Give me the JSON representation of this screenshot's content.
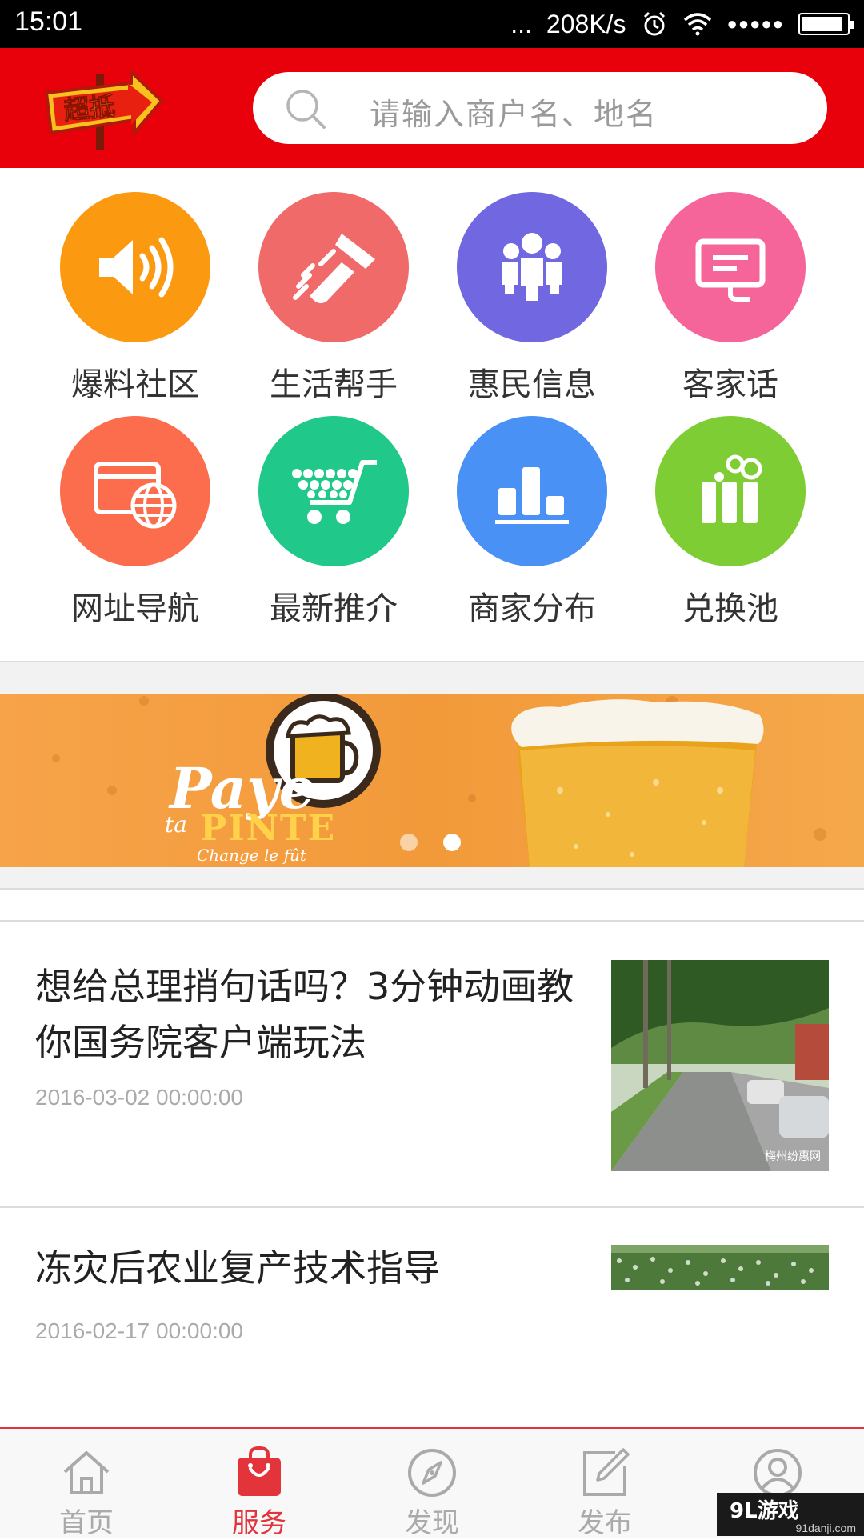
{
  "status_bar": {
    "time": "15:01",
    "signal_dots": "...",
    "speed": "208K/s",
    "cell_signal": "●●●●●"
  },
  "header": {
    "logo_text": "超抵",
    "search_placeholder": "请输入商户名、地名"
  },
  "categories": [
    {
      "label": "爆料社区",
      "color": "#fb9a11",
      "icon": "speaker-icon"
    },
    {
      "label": "生活帮手",
      "color": "#f06a69",
      "icon": "handshake-icon"
    },
    {
      "label": "惠民信息",
      "color": "#7067e1",
      "icon": "people-icon"
    },
    {
      "label": "客家话",
      "color": "#f6659a",
      "icon": "monitor-icon"
    },
    {
      "label": "网址导航",
      "color": "#fb6d4c",
      "icon": "web-globe-icon"
    },
    {
      "label": "最新推介",
      "color": "#20c88a",
      "icon": "cart-icon"
    },
    {
      "label": "商家分布",
      "color": "#4a91f5",
      "icon": "bar-chart-icon"
    },
    {
      "label": "兑换池",
      "color": "#7fcd35",
      "icon": "gift-icon"
    }
  ],
  "banner": {
    "line1": "Paye",
    "line2": "ta",
    "line3": "PINTE",
    "line4": "Change le fût",
    "slides": 2,
    "active_slide": 2
  },
  "articles": [
    {
      "title": "想给总理捎句话吗？3分钟动画教你国务院客户端玩法",
      "date": "2016-03-02 00:00:00",
      "thumb_watermark": "梅州纷惠网"
    },
    {
      "title": "冻灾后农业复产技术指导",
      "date": "2016-02-17 00:00:00"
    }
  ],
  "tabs": [
    {
      "label": "首页",
      "icon": "home-icon",
      "active": false
    },
    {
      "label": "服务",
      "icon": "shopping-bag-icon",
      "active": true
    },
    {
      "label": "发现",
      "icon": "compass-icon",
      "active": false
    },
    {
      "label": "发布",
      "icon": "edit-icon",
      "active": false
    },
    {
      "label": "",
      "icon": "user-icon",
      "active": false
    }
  ],
  "watermark": {
    "brand": "9L游戏",
    "url": "91danji.com"
  },
  "colors": {
    "primary": "#e8000b",
    "tab_active": "#e3333b"
  }
}
